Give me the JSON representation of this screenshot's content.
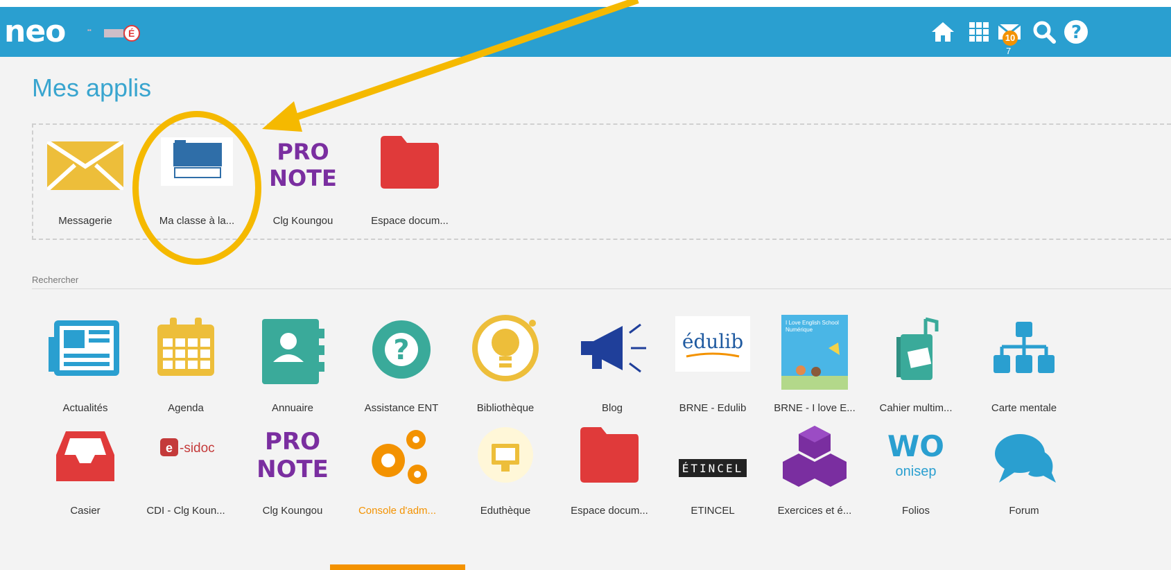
{
  "header": {
    "logo_text": "neo",
    "brand_color": "#2a9fd0",
    "notification_count": "10",
    "notification_sub": "7",
    "icons": [
      "home-icon",
      "apps-grid-icon",
      "mail-icon",
      "search-icon",
      "help-icon"
    ]
  },
  "page": {
    "title": "Mes applis"
  },
  "favorites": [
    {
      "label": "Messagerie",
      "icon": "mail-envelope-icon"
    },
    {
      "label": "Ma classe à la...",
      "icon": "ma-classe-college-logo"
    },
    {
      "label": "Clg Koungou",
      "icon": "pronote-logo",
      "logo_text": "PRO NOTE"
    },
    {
      "label": "Espace docum...",
      "icon": "folder-icon"
    }
  ],
  "search": {
    "label": "Rechercher"
  },
  "apps_row1": [
    {
      "label": "Actualités",
      "icon": "newspaper-icon"
    },
    {
      "label": "Agenda",
      "icon": "calendar-icon"
    },
    {
      "label": "Annuaire",
      "icon": "contacts-book-icon"
    },
    {
      "label": "Assistance ENT",
      "icon": "question-circle-icon"
    },
    {
      "label": "Bibliothèque",
      "icon": "lightbulb-icon"
    },
    {
      "label": "Blog",
      "icon": "megaphone-icon"
    },
    {
      "label": "BRNE - Edulib",
      "icon": "edulib-logo",
      "logo_text": "édulib"
    },
    {
      "label": "BRNE - I love E...",
      "icon": "i-love-english-logo",
      "logo_text": "I Love English School Numérique"
    },
    {
      "label": "Cahier multim...",
      "icon": "multimedia-notebook-icon"
    },
    {
      "label": "Carte mentale",
      "icon": "mind-map-icon"
    }
  ],
  "apps_row2": [
    {
      "label": "Casier",
      "icon": "inbox-tray-icon"
    },
    {
      "label": "CDI - Clg Koun...",
      "icon": "esidoc-logo",
      "logo_text": "e-sidoc"
    },
    {
      "label": "Clg Koungou",
      "icon": "pronote-logo",
      "logo_text": "PRO NOTE"
    },
    {
      "label": "Console d'adm...",
      "icon": "gears-icon"
    },
    {
      "label": "Eduthèque",
      "icon": "screen-icon"
    },
    {
      "label": "Espace docum...",
      "icon": "folder-icon"
    },
    {
      "label": "ETINCEL",
      "icon": "etincel-logo",
      "logo_text": "ÉTINCEL"
    },
    {
      "label": "Exercices et é...",
      "icon": "cubes-icon"
    },
    {
      "label": "Folios",
      "icon": "folios-onisep-logo",
      "logo_text": "WO onisep"
    },
    {
      "label": "Forum",
      "icon": "chat-bubbles-icon"
    }
  ],
  "colors": {
    "accent_blue": "#2a9fd0",
    "title_blue": "#39a5cf",
    "highlight_yellow": "#f5b900",
    "orange": "#f39200",
    "teal": "#3aaa9a",
    "red": "#e03a3a",
    "purple": "#7a2ea0"
  }
}
